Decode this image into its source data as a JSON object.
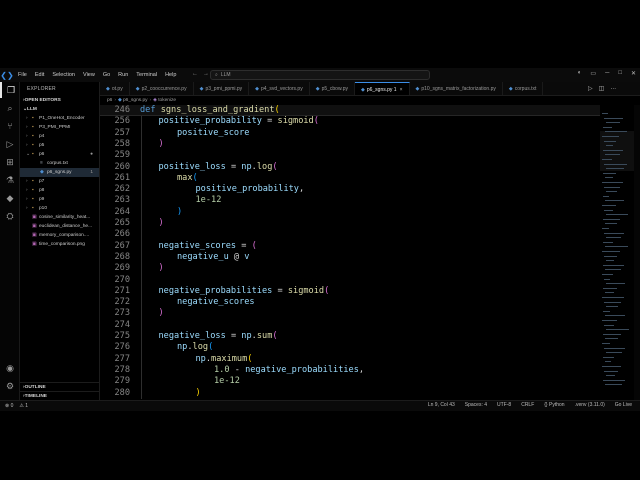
{
  "titlebar": {
    "menu": [
      "File",
      "Edit",
      "Selection",
      "View",
      "Go",
      "Run",
      "Terminal",
      "Help"
    ],
    "search_text": "LLM"
  },
  "sidebar": {
    "explorer_label": "EXPLORER",
    "open_editors_label": "OPEN EDITORS",
    "root_label": "LLM",
    "items": [
      {
        "label": "P1_OneHot_Encoder",
        "type": "folder",
        "depth": 1
      },
      {
        "label": "P3_PMI_PPMI",
        "type": "folder",
        "depth": 1
      },
      {
        "label": "p4",
        "type": "folder",
        "depth": 1
      },
      {
        "label": "p5",
        "type": "folder",
        "depth": 1
      },
      {
        "label": "p6",
        "type": "folder-open",
        "depth": 1,
        "badge": "●"
      },
      {
        "label": "corpus.txt",
        "type": "txt",
        "depth": 2
      },
      {
        "label": "p6_sgns.py",
        "type": "py",
        "depth": 2,
        "badge": "1",
        "selected": true
      },
      {
        "label": "p7",
        "type": "folder",
        "depth": 1
      },
      {
        "label": "p8",
        "type": "folder",
        "depth": 1
      },
      {
        "label": "p9",
        "type": "folder",
        "depth": 1
      },
      {
        "label": "p10",
        "type": "folder",
        "depth": 1
      },
      {
        "label": "cosine_similarity_heat...",
        "type": "png",
        "depth": 1
      },
      {
        "label": "euclidean_distance_he...",
        "type": "png",
        "depth": 1
      },
      {
        "label": "memory_comparison....",
        "type": "png",
        "depth": 1
      },
      {
        "label": "time_comparison.png",
        "type": "png",
        "depth": 1
      }
    ],
    "outline_label": "OUTLINE",
    "timeline_label": "TIMELINE"
  },
  "tabs": [
    {
      "label": "ot.py"
    },
    {
      "label": "p2_cooccurrence.py"
    },
    {
      "label": "p3_pmi_ppmi.py"
    },
    {
      "label": "p4_svd_vectors.py"
    },
    {
      "label": "p5_cbow.py"
    },
    {
      "label": "p6_sgns.py 1",
      "active": true
    },
    {
      "label": "p10_sgns_matrix_factorization.py"
    },
    {
      "label": "corpus.txt"
    }
  ],
  "breadcrumb": [
    "p6",
    "p6_sgns.py",
    "tokenize"
  ],
  "editor": {
    "sticky": {
      "num": "246",
      "tokens": [
        [
          "kw",
          "def "
        ],
        [
          "fn",
          "sgns_loss_and_gradient"
        ],
        [
          "br1",
          "("
        ]
      ]
    },
    "lines": [
      {
        "num": "256",
        "indent": 1,
        "tokens": [
          [
            "var",
            "positive_probability"
          ],
          [
            "plain",
            " = "
          ],
          [
            "fn",
            "sigmoid"
          ],
          [
            "br2",
            "("
          ]
        ]
      },
      {
        "num": "257",
        "indent": 2,
        "tokens": [
          [
            "var",
            "positive_score"
          ]
        ]
      },
      {
        "num": "258",
        "indent": 1,
        "tokens": [
          [
            "br2",
            ")"
          ]
        ]
      },
      {
        "num": "259",
        "indent": 0,
        "tokens": []
      },
      {
        "num": "260",
        "indent": 1,
        "tokens": [
          [
            "var",
            "positive_loss"
          ],
          [
            "plain",
            " = "
          ],
          [
            "var",
            "np"
          ],
          [
            "plain",
            "."
          ],
          [
            "fn",
            "log"
          ],
          [
            "br2",
            "("
          ]
        ]
      },
      {
        "num": "261",
        "indent": 2,
        "tokens": [
          [
            "fn",
            "max"
          ],
          [
            "br3",
            "("
          ]
        ]
      },
      {
        "num": "262",
        "indent": 3,
        "tokens": [
          [
            "var",
            "positive_probability"
          ],
          [
            "plain",
            ","
          ]
        ]
      },
      {
        "num": "263",
        "indent": 3,
        "tokens": [
          [
            "num",
            "1e-12"
          ]
        ]
      },
      {
        "num": "264",
        "indent": 2,
        "tokens": [
          [
            "br3",
            ")"
          ]
        ]
      },
      {
        "num": "265",
        "indent": 1,
        "tokens": [
          [
            "br2",
            ")"
          ]
        ]
      },
      {
        "num": "266",
        "indent": 0,
        "tokens": []
      },
      {
        "num": "267",
        "indent": 1,
        "tokens": [
          [
            "var",
            "negative_scores"
          ],
          [
            "plain",
            " = "
          ],
          [
            "br2",
            "("
          ]
        ]
      },
      {
        "num": "268",
        "indent": 2,
        "tokens": [
          [
            "var",
            "negative_u"
          ],
          [
            "plain",
            " @ "
          ],
          [
            "var",
            "v"
          ]
        ]
      },
      {
        "num": "269",
        "indent": 1,
        "tokens": [
          [
            "br2",
            ")"
          ]
        ]
      },
      {
        "num": "270",
        "indent": 0,
        "tokens": []
      },
      {
        "num": "271",
        "indent": 1,
        "tokens": [
          [
            "var",
            "negative_probabilities"
          ],
          [
            "plain",
            " = "
          ],
          [
            "fn",
            "sigmoid"
          ],
          [
            "br2",
            "("
          ]
        ]
      },
      {
        "num": "272",
        "indent": 2,
        "tokens": [
          [
            "var",
            "negative_scores"
          ]
        ]
      },
      {
        "num": "273",
        "indent": 1,
        "tokens": [
          [
            "br2",
            ")"
          ]
        ]
      },
      {
        "num": "274",
        "indent": 0,
        "tokens": []
      },
      {
        "num": "275",
        "indent": 1,
        "tokens": [
          [
            "var",
            "negative_loss"
          ],
          [
            "plain",
            " = "
          ],
          [
            "var",
            "np"
          ],
          [
            "plain",
            "."
          ],
          [
            "fn",
            "sum"
          ],
          [
            "br2",
            "("
          ]
        ]
      },
      {
        "num": "276",
        "indent": 2,
        "tokens": [
          [
            "var",
            "np"
          ],
          [
            "plain",
            "."
          ],
          [
            "fn",
            "log"
          ],
          [
            "br3",
            "("
          ]
        ]
      },
      {
        "num": "277",
        "indent": 3,
        "tokens": [
          [
            "var",
            "np"
          ],
          [
            "plain",
            "."
          ],
          [
            "fn",
            "maximum"
          ],
          [
            "br1",
            "("
          ]
        ]
      },
      {
        "num": "278",
        "indent": 4,
        "tokens": [
          [
            "num",
            "1.0"
          ],
          [
            "plain",
            " - "
          ],
          [
            "var",
            "negative_probabilities"
          ],
          [
            "plain",
            ","
          ]
        ]
      },
      {
        "num": "279",
        "indent": 4,
        "tokens": [
          [
            "num",
            "1e-12"
          ]
        ]
      },
      {
        "num": "280",
        "indent": 3,
        "tokens": [
          [
            "br1",
            ")"
          ]
        ]
      }
    ]
  },
  "statusbar": {
    "left": [
      "⊗ 0",
      "⚠ 1"
    ],
    "right": [
      "Ln 9, Col 43",
      "Spaces: 4",
      "UTF-8",
      "CRLF",
      "{} Python",
      ".venv (3.11.0)",
      "Go Live"
    ]
  },
  "colors": {
    "accent": "#3b8ee8",
    "background": "#000000"
  }
}
